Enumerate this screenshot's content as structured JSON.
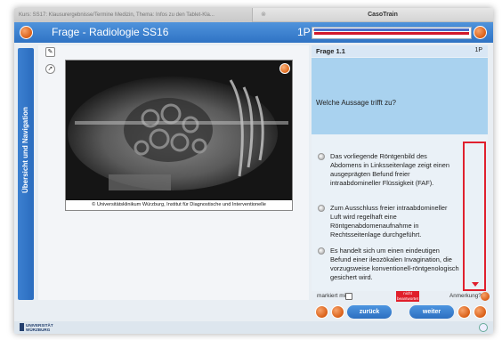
{
  "browser": {
    "tab_left_title": "Kurs: SS17: Klausurergebnisse/Termine Medizin, Thema: Infos zu den Tablet-Kla...",
    "tab_right_title": "CasoTrain"
  },
  "header": {
    "title": "Frage - Radiologie SS16",
    "points": "1P",
    "progress_marker": "B"
  },
  "sidebar": {
    "label": "Übersicht und Navigation"
  },
  "image": {
    "caption": "© Universitätsklinikum Würzburg, Institut für Diagnostische und Interventionelle"
  },
  "question": {
    "label": "Frage 1.1",
    "points": "1P",
    "text": "Welche Aussage trifft zu?",
    "answers": [
      "Das vorliegende Röntgenbild des Abdomens in Linksseitenlage zeigt einen ausgeprägten Befund freier intraabdomineller Flüssigkeit (FAF).",
      "Zum Ausschluss freier intraabdomineller Luft wird regelhaft eine Röntgenabdomenaufnahme in Rechtsseitenlage durchgeführt.",
      "Es handelt sich um einen eindeutigen Befund einer ileozökalen Invagination, die vorzugsweise konventionell-röntgenologisch gesichert wird."
    ]
  },
  "bottom": {
    "mark_label": "markiert mit",
    "unanswered_label": "nicht beantwortet",
    "annotation_label": "Anmerkung?",
    "back_label": "zurück",
    "next_label": "weiter"
  },
  "footer": {
    "logo_line1": "UNIVERSITÄT",
    "logo_line2": "WÜRZBURG"
  },
  "colors": {
    "accent_blue": "#2f73c4",
    "accent_orange": "#d95f17",
    "alert_red": "#e0202e"
  }
}
